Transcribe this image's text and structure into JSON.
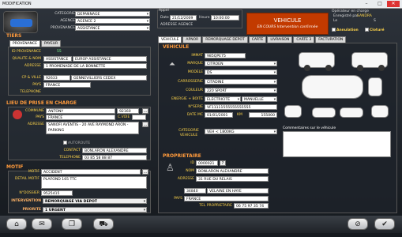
{
  "window": {
    "title": "MODIFICATION",
    "min": "–",
    "max": "□",
    "close": "✕"
  },
  "header": {
    "categorie_label": "CATEGORIE",
    "categorie": "DEPANNAGE",
    "agence_label": "AGENCE",
    "agence": "AGENCE 2",
    "provenance_label": "PROVENANCE",
    "provenance": "ASSISTANCE",
    "appel_label": "Appel",
    "date_label": "Date",
    "date": "21/12/2009",
    "heure_label": "Heure",
    "heure": "10:00:00",
    "adresse_agence": "ADRESSE AGENCE",
    "status_title": "VEHICULE",
    "status_sub": "EN COURS Intervention confirmée",
    "operateur_label": "Opérateur en charge",
    "enregistre_label": "Enregistré par",
    "enregistre": "SANDRA",
    "le_label": "Le",
    "annulation": "Annulation",
    "cloture": "Cloturé",
    "s_label": "S"
  },
  "tiers": {
    "title": "TIERS",
    "tabs": [
      "PROVENANCE",
      "PAYEUR"
    ],
    "id_label": "ID PROVENANCE",
    "id": "55",
    "qualite_label": "QUALITE & NOM",
    "qualite": "ASSISTANCE",
    "nom": "EUROP ASSISTANCE",
    "adresse_label": "ADRESSE",
    "adresse": "1 PROMENADE DE LA BONNETTE",
    "cp_label": "CP & VILLE",
    "cp": "92633",
    "ville": "GENNEVILLIERS CEDEX",
    "pays_label": "PAYS",
    "pays": "FRANCE",
    "tel_label": "TELEPHONE"
  },
  "prise": {
    "title": "LIEU DE PRISE EN CHARGE",
    "commune_label": "COMMUNE",
    "commune": "ANTONY",
    "cp": "92160",
    "pays_label": "PAYS",
    "pays": "FRANCE",
    "cvoie_label": "C.VOIE",
    "adresse_label": "ADRESSE",
    "adresse": "SANOFI AVENTIS - 20 AVE RAYMOND ARON - PARKING",
    "autoroute": "AUTOROUTE",
    "contact_label": "CONTACT",
    "contact": "BONLARON ALEXANDRE",
    "telephone_label": "TELEPHONE",
    "telephone": "03 85 58 88 87"
  },
  "motif": {
    "title": "MOTIF",
    "motif_label": "MOTIF",
    "motif": "ACCIDENT",
    "detail_label": "DETAIL MOTIF",
    "detail": "PLAFOND 165 TTC",
    "dossier_label": "N°DOSSIER",
    "dossier": "9525415",
    "intervention_label": "INTERVENTION",
    "intervention": "REMORQUAGE VIA DEPOT",
    "priorite_label": "PRIORITE",
    "priorite": "1 URGENT"
  },
  "tabs": [
    "VEHICULE",
    "APNOR",
    "REMORQUAGE DEPOT",
    "CARTE",
    "LIVRAISON",
    "CARTE 3",
    "FACTURATION"
  ],
  "vehicule": {
    "title": "VEHICULE",
    "immat_label": "IMMAT",
    "immat": "985QPE75",
    "marque_label": "MARQUE",
    "marque": "CITROEN",
    "modele_label": "MODELE",
    "modele": "DS",
    "carrosserie_label": "CARROSSERIE",
    "carrosserie": "CITADINE",
    "couleur_label": "COULEUR",
    "couleur": "220 SPORT",
    "energie_label": "ENERGIE + BOITE",
    "energie": "ELECTRICITE",
    "boite": "MANUELLE",
    "serie_label": "N°SERIE",
    "serie": "VF11111555555555555",
    "date_label": "DATE MC",
    "date": "01/01/2001",
    "km_label": "KM",
    "km": "155000",
    "categorie_label": "CATEGORIE VEHICULE",
    "categorie": "VEH < 1800KG",
    "commentaires_label": "Commentaires sur le véhicule"
  },
  "proprietaire": {
    "title": "PROPRIETAIRE",
    "id_label": "ID",
    "id": "0000021",
    "nom_label": "NOM",
    "nom": "BONLARON ALEXANDRE",
    "adresse_label": "ADRESSE",
    "adresse": "31 RUE DU RELAIS",
    "cp": "34840",
    "ville": "VELAINE EN HAYE",
    "pays_label": "PAYS",
    "pays": "FRANCE",
    "tel_label": "TEL PROPRIETAIRE",
    "tel": "06 75 97 35 74"
  },
  "toolbar": {
    "icons": [
      "home-icon",
      "chat-icon",
      "copy-icon",
      "car-icon",
      "cancel-icon",
      "check-icon"
    ],
    "glyphs": [
      "⌂",
      "✉",
      "❐",
      "⛟",
      "⊘",
      "✔"
    ]
  },
  "colors": {
    "accent": "#ff9a3c",
    "field": "#ffffff",
    "status_bg": "#c23a00"
  }
}
